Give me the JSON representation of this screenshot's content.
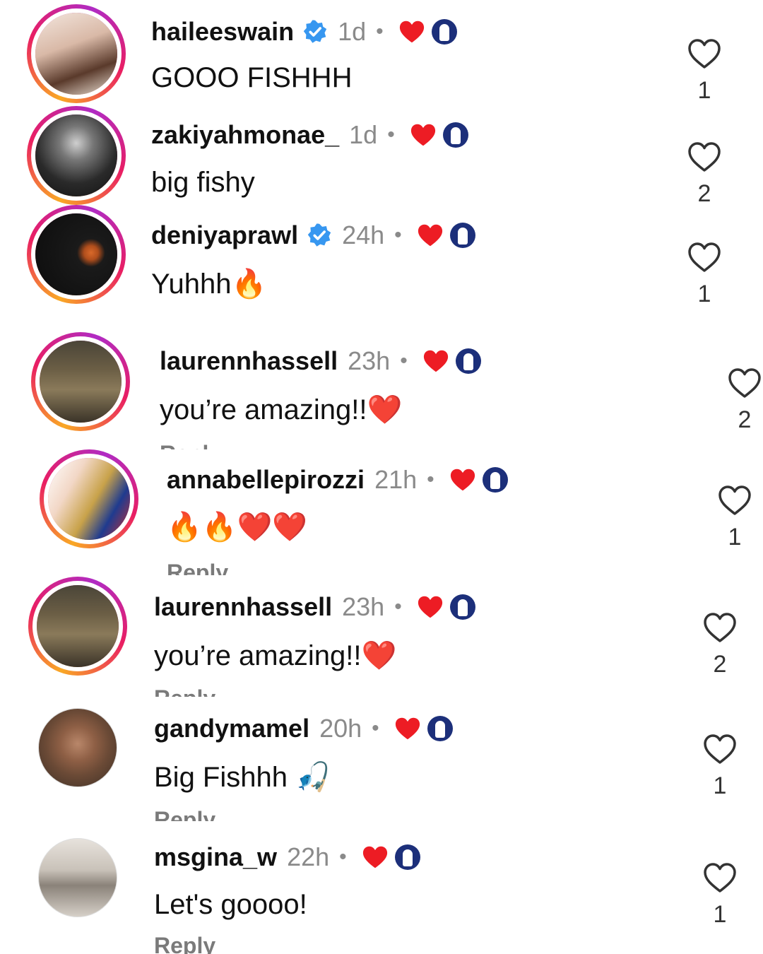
{
  "comments": [
    {
      "username": "haileeswain",
      "verified": true,
      "time": "1d",
      "text": "GOOO FISHHH",
      "reply": "",
      "likes": "1"
    },
    {
      "username": "zakiyahmonae_",
      "verified": false,
      "time": "1d",
      "text": "big fishy",
      "reply": "",
      "likes": "2"
    },
    {
      "username": "deniyaprawl",
      "verified": true,
      "time": "24h",
      "text": "Yuhhh🔥",
      "reply": "",
      "likes": "1"
    },
    {
      "username": "laurennhassell",
      "verified": false,
      "time": "23h",
      "text": "you’re amazing!!❤️",
      "reply": "Reply",
      "likes": "2"
    },
    {
      "username": "annabellepirozzi",
      "verified": false,
      "time": "21h",
      "text": "🔥🔥❤️❤️",
      "reply": "Reply",
      "likes": "1"
    },
    {
      "username": "laurennhassell",
      "verified": false,
      "time": "23h",
      "text": "you’re amazing!!❤️",
      "reply": "Reply",
      "likes": "2"
    },
    {
      "username": "gandymamel",
      "verified": false,
      "time": "20h",
      "text": "Big Fishhh 🎣",
      "reply": "Reply",
      "likes": "1"
    },
    {
      "username": "msgina_w",
      "verified": false,
      "time": "22h",
      "text": "Let's goooo!",
      "reply": "Reply",
      "likes": "1"
    }
  ],
  "separator": "•",
  "colors": {
    "accent_heart": "#ed1c24",
    "verified": "#3797f0",
    "muted": "#8a8a8a"
  }
}
